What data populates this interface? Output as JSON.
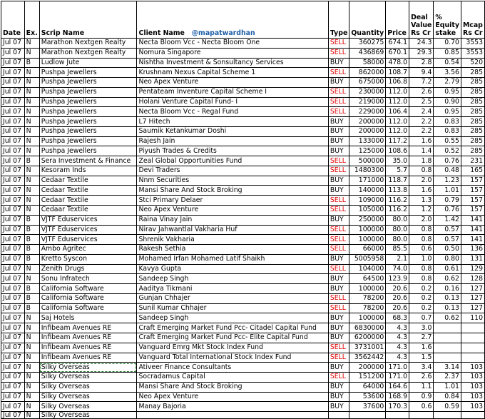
{
  "header": {
    "date": "Date",
    "exchange": "Ex.",
    "scrip": "Scrip Name",
    "client": "Client Name",
    "handle": "@mapatwardhan",
    "type": "Type",
    "quantity": "Quantity",
    "price": "Price",
    "deal_value": "Deal Value Rs Cr",
    "equity_stake": "% Equity stake",
    "mcap": "Mcap Rs Cr"
  },
  "rows": [
    {
      "date": "Jul 07",
      "ex": "N",
      "scrip": "Marathon Nextgen Realty",
      "client": "Necta Bloom Vcc - Necta Bloom One",
      "type": "SELL",
      "qty": "360275",
      "price": "674.1",
      "deal": "24.3",
      "stake": "0.70",
      "mcap": "3553"
    },
    {
      "date": "Jul 07",
      "ex": "N",
      "scrip": "Marathon Nextgen Realty",
      "client": "Nomura Singapore",
      "type": "SELL",
      "qty": "436869",
      "price": "670.1",
      "deal": "29.3",
      "stake": "0.85",
      "mcap": "3553"
    },
    {
      "date": "Jul 07",
      "ex": "B",
      "scrip": "Ludlow Jute",
      "client": "Nishtha Investment & Sonsultancy Services",
      "type": "BUY",
      "qty": "58000",
      "price": "478.0",
      "deal": "2.8",
      "stake": "0.54",
      "mcap": "520"
    },
    {
      "date": "Jul 07",
      "ex": "N",
      "scrip": "Pushpa Jewellers",
      "client": "Krushnam Nexus Capital Scheme 1",
      "type": "SELL",
      "qty": "862000",
      "price": "108.7",
      "deal": "9.4",
      "stake": "3.56",
      "mcap": "285"
    },
    {
      "date": "Jul 07",
      "ex": "N",
      "scrip": "Pushpa Jewellers",
      "client": "Neo Apex Venture",
      "type": "BUY",
      "qty": "675000",
      "price": "106.8",
      "deal": "7.2",
      "stake": "2.79",
      "mcap": "285"
    },
    {
      "date": "Jul 07",
      "ex": "N",
      "scrip": "Pushpa Jewellers",
      "client": "Pentateam Inventure Capital Scheme I",
      "type": "SELL",
      "qty": "230000",
      "price": "112.0",
      "deal": "2.6",
      "stake": "0.95",
      "mcap": "285"
    },
    {
      "date": "Jul 07",
      "ex": "N",
      "scrip": "Pushpa Jewellers",
      "client": "Holani Venture Capital Fund- I",
      "type": "SELL",
      "qty": "219000",
      "price": "112.0",
      "deal": "2.5",
      "stake": "0.90",
      "mcap": "285"
    },
    {
      "date": "Jul 07",
      "ex": "N",
      "scrip": "Pushpa Jewellers",
      "client": "Necta Bloom Vcc - Regal Fund",
      "type": "SELL",
      "qty": "229000",
      "price": "106.4",
      "deal": "2.4",
      "stake": "0.95",
      "mcap": "285"
    },
    {
      "date": "Jul 07",
      "ex": "N",
      "scrip": "Pushpa Jewellers",
      "client": "L7 Hitech",
      "type": "BUY",
      "qty": "200000",
      "price": "112.0",
      "deal": "2.2",
      "stake": "0.83",
      "mcap": "285"
    },
    {
      "date": "Jul 07",
      "ex": "N",
      "scrip": "Pushpa Jewellers",
      "client": "Saumik Ketankumar Doshi",
      "type": "BUY",
      "qty": "200000",
      "price": "112.0",
      "deal": "2.2",
      "stake": "0.83",
      "mcap": "285"
    },
    {
      "date": "Jul 07",
      "ex": "N",
      "scrip": "Pushpa Jewellers",
      "client": "Rajesh Jain",
      "type": "BUY",
      "qty": "133000",
      "price": "117.2",
      "deal": "1.6",
      "stake": "0.55",
      "mcap": "285"
    },
    {
      "date": "Jul 07",
      "ex": "N",
      "scrip": "Pushpa Jewellers",
      "client": "Piyush Trades & Credits",
      "type": "BUY",
      "qty": "125000",
      "price": "108.6",
      "deal": "1.4",
      "stake": "0.52",
      "mcap": "285"
    },
    {
      "date": "Jul 07",
      "ex": "B",
      "scrip": "Sera Investment & Finance",
      "client": "Zeal Global Opportunities Fund",
      "type": "SELL",
      "qty": "500000",
      "price": "35.0",
      "deal": "1.8",
      "stake": "0.76",
      "mcap": "231"
    },
    {
      "date": "Jul 07",
      "ex": "N",
      "scrip": "Kesoram Inds",
      "client": "Devi Traders",
      "type": "SELL",
      "qty": "1480300",
      "price": "5.7",
      "deal": "0.8",
      "stake": "0.48",
      "mcap": "165"
    },
    {
      "date": "Jul 07",
      "ex": "N",
      "scrip": "Cedaar Textile",
      "client": "Nnm Securities",
      "type": "BUY",
      "qty": "171000",
      "price": "118.7",
      "deal": "2.0",
      "stake": "1.23",
      "mcap": "157"
    },
    {
      "date": "Jul 07",
      "ex": "N",
      "scrip": "Cedaar Textile",
      "client": "Mansi Share And Stock Broking",
      "type": "BUY",
      "qty": "140000",
      "price": "113.8",
      "deal": "1.6",
      "stake": "1.01",
      "mcap": "157"
    },
    {
      "date": "Jul 07",
      "ex": "N",
      "scrip": "Cedaar Textile",
      "client": "Stci Primary Delaer",
      "type": "SELL",
      "qty": "109000",
      "price": "116.2",
      "deal": "1.3",
      "stake": "0.79",
      "mcap": "157"
    },
    {
      "date": "Jul 07",
      "ex": "N",
      "scrip": "Cedaar Textile",
      "client": "Neo Apex Venture",
      "type": "SELL",
      "qty": "105000",
      "price": "116.2",
      "deal": "1.2",
      "stake": "0.76",
      "mcap": "157"
    },
    {
      "date": "Jul 07",
      "ex": "B",
      "scrip": "VJTF Eduservices",
      "client": "Raina Vinay Jain",
      "type": "BUY",
      "qty": "250000",
      "price": "80.0",
      "deal": "2.0",
      "stake": "1.42",
      "mcap": "141"
    },
    {
      "date": "Jul 07",
      "ex": "B",
      "scrip": "VJTF Eduservices",
      "client": "Nirav Jahwantlal Vakharia Huf",
      "type": "SELL",
      "qty": "100000",
      "price": "80.0",
      "deal": "0.8",
      "stake": "0.57",
      "mcap": "141"
    },
    {
      "date": "Jul 07",
      "ex": "B",
      "scrip": "VJTF Eduservices",
      "client": "Shrenik Vakharia",
      "type": "SELL",
      "qty": "100000",
      "price": "80.0",
      "deal": "0.8",
      "stake": "0.57",
      "mcap": "141"
    },
    {
      "date": "Jul 07",
      "ex": "B",
      "scrip": "Ambo Agritec",
      "client": "Rakesh Sethia",
      "type": "SELL",
      "qty": "66000",
      "price": "85.5",
      "deal": "0.6",
      "stake": "0.50",
      "mcap": "136"
    },
    {
      "date": "Jul 07",
      "ex": "B",
      "scrip": "Kretto Syscon",
      "client": "Mohamed Irfan Mohamed Latif Shaikh",
      "type": "BUY",
      "qty": "5005958",
      "price": "2.1",
      "deal": "1.0",
      "stake": "0.80",
      "mcap": "131"
    },
    {
      "date": "Jul 07",
      "ex": "N",
      "scrip": "Zenith Drugs",
      "client": "Kavya Gupta",
      "type": "SELL",
      "qty": "104000",
      "price": "74.0",
      "deal": "0.8",
      "stake": "0.61",
      "mcap": "129"
    },
    {
      "date": "Jul 07",
      "ex": "N",
      "scrip": "Sonu Infratech",
      "client": "Sandeep Singh",
      "type": "BUY",
      "qty": "64500",
      "price": "123.9",
      "deal": "0.8",
      "stake": "0.62",
      "mcap": "128"
    },
    {
      "date": "Jul 07",
      "ex": "B",
      "scrip": "California Software",
      "client": "Aaditya Tikmani",
      "type": "BUY",
      "qty": "100000",
      "price": "20.6",
      "deal": "0.2",
      "stake": "0.16",
      "mcap": "127"
    },
    {
      "date": "Jul 07",
      "ex": "B",
      "scrip": "California Software",
      "client": "Gunjan Chhajer",
      "type": "SELL",
      "qty": "78200",
      "price": "20.6",
      "deal": "0.2",
      "stake": "0.13",
      "mcap": "127"
    },
    {
      "date": "Jul 07",
      "ex": "B",
      "scrip": "California Software",
      "client": "Sunil Kumar Chhajer",
      "type": "SELL",
      "qty": "78200",
      "price": "20.6",
      "deal": "0.2",
      "stake": "0.13",
      "mcap": "127"
    },
    {
      "date": "Jul 07",
      "ex": "N",
      "scrip": "Saj Hotels",
      "client": "Sandeep Singh",
      "type": "BUY",
      "qty": "100000",
      "price": "68.3",
      "deal": "0.7",
      "stake": "0.62",
      "mcap": "110"
    },
    {
      "date": "Jul 07",
      "ex": "N",
      "scrip": "Infibeam Avenues RE",
      "client": "Craft Emerging Market Fund Pcc- Citadel Capital Fund",
      "type": "BUY",
      "qty": "6830000",
      "price": "4.3",
      "deal": "3.0",
      "stake": "",
      "mcap": ""
    },
    {
      "date": "Jul 07",
      "ex": "N",
      "scrip": "Infibeam Avenues RE",
      "client": "Craft Emerging Market Fund Pcc- Elite Capital Fund",
      "type": "BUY",
      "qty": "6200000",
      "price": "4.3",
      "deal": "2.7",
      "stake": "",
      "mcap": ""
    },
    {
      "date": "Jul 07",
      "ex": "N",
      "scrip": "Infibeam Avenues RE",
      "client": "Vanguard Emrg Mkt Stock Index Fund",
      "type": "SELL",
      "qty": "3731001",
      "price": "4.3",
      "deal": "1.6",
      "stake": "",
      "mcap": ""
    },
    {
      "date": "Jul 07",
      "ex": "N",
      "scrip": "Infibeam Avenues RE",
      "client": "Vanguard Total International Stock Index Fund",
      "type": "SELL",
      "qty": "3562442",
      "price": "4.3",
      "deal": "1.5",
      "stake": "",
      "mcap": ""
    },
    {
      "date": "Jul 07",
      "ex": "N",
      "scrip": "Silky Overseas",
      "client": "Ativeer Finance Consultants",
      "type": "BUY",
      "qty": "200000",
      "price": "171.0",
      "deal": "3.4",
      "stake": "3.14",
      "mcap": "103"
    },
    {
      "date": "Jul 07",
      "ex": "N",
      "scrip": "Silky Overseas",
      "client": "Socradamus Capital",
      "type": "SELL",
      "qty": "151200",
      "price": "171.0",
      "deal": "2.6",
      "stake": "2.37",
      "mcap": "103"
    },
    {
      "date": "Jul 07",
      "ex": "N",
      "scrip": "Silky Overseas",
      "client": "Mansi Share And Stock Broking",
      "type": "BUY",
      "qty": "64000",
      "price": "164.6",
      "deal": "1.1",
      "stake": "1.01",
      "mcap": "103"
    },
    {
      "date": "Jul 07",
      "ex": "N",
      "scrip": "Silky Overseas",
      "client": "Neo Apex Venture",
      "type": "BUY",
      "qty": "53600",
      "price": "168.9",
      "deal": "0.9",
      "stake": "0.84",
      "mcap": "103"
    },
    {
      "date": "Jul 07",
      "ex": "N",
      "scrip": "Silky Overseas",
      "client": "Manay Bajoria",
      "type": "BUY",
      "qty": "37600",
      "price": "170.3",
      "deal": "0.6",
      "stake": "0.59",
      "mcap": "103"
    },
    {
      "date": "Jul 07",
      "ex": "N",
      "scrip": "Silky Overseas",
      "client": "",
      "type": "",
      "qty": "",
      "price": "",
      "deal": "",
      "stake": "",
      "mcap": ""
    }
  ]
}
